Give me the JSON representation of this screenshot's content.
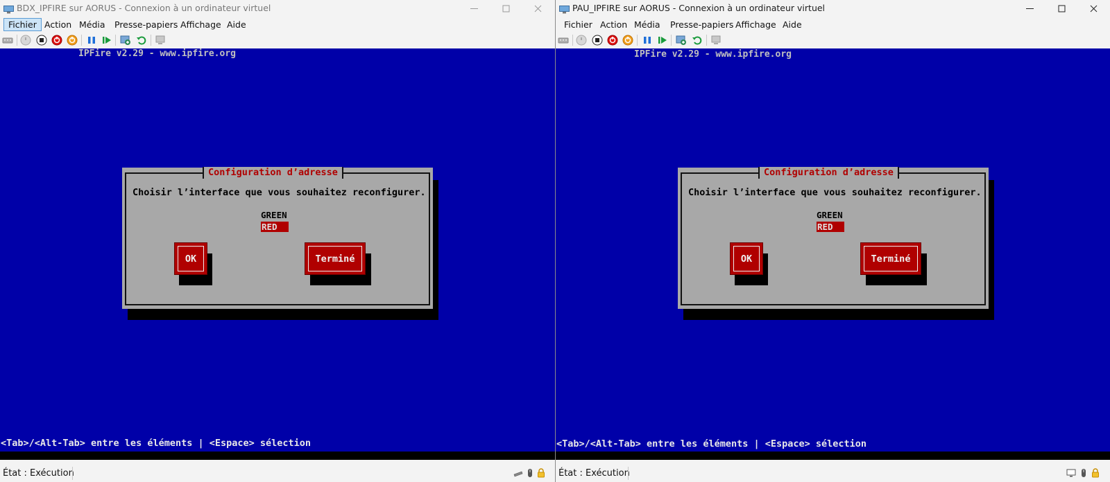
{
  "windows": [
    {
      "title": "BDX_IPFIRE sur AORUS - Connexion à un ordinateur virtuel",
      "menu": [
        "Fichier",
        "Action",
        "Média",
        "Presse-papiers",
        "Affichage",
        "Aide"
      ],
      "active_menu": "Fichier",
      "console": {
        "header": "IPFire v2.29 - www.ipfire.org",
        "dialog_title": "Configuration d’adresse",
        "dialog_message": "Choisir l’interface que vous souhaitez reconfigurer.",
        "options": [
          "GREEN",
          "RED"
        ],
        "selected_option": "RED",
        "ok_label": "OK",
        "done_label": "Terminé",
        "footer": "<Tab>/<Alt-Tab> entre les éléments | <Espace> sélection"
      },
      "status": "État : Exécution"
    },
    {
      "title": "PAU_IPFIRE sur AORUS - Connexion à un ordinateur virtuel",
      "menu": [
        "Fichier",
        "Action",
        "Média",
        "Presse-papiers",
        "Affichage",
        "Aide"
      ],
      "console": {
        "header": "IPFire v2.29 - www.ipfire.org",
        "dialog_title": "Configuration d’adresse",
        "dialog_message": "Choisir l’interface que vous souhaitez reconfigurer.",
        "options": [
          "GREEN",
          "RED"
        ],
        "selected_option": "RED",
        "ok_label": "OK",
        "done_label": "Terminé",
        "footer": "<Tab>/<Alt-Tab> entre les éléments | <Espace> sélection"
      },
      "status": "État : Exécution"
    }
  ],
  "toolbar_icons": [
    "ctrl-alt-del-icon",
    "start-icon",
    "turn-off-icon",
    "shut-down-icon",
    "save-state-icon",
    "pause-icon",
    "resume-icon",
    "checkpoint-icon",
    "revert-icon",
    "enhanced-session-icon"
  ],
  "colors": {
    "console_background": "#0000a8",
    "dialog_background": "#a8a8a8",
    "accent_red": "#b00000",
    "menu_highlight": "#cce4f7"
  }
}
